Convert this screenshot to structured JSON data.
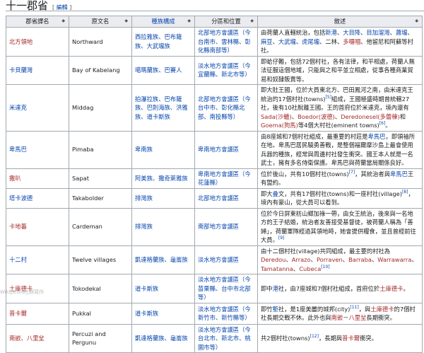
{
  "section": {
    "title": "十一郡省",
    "edit_label": "編輯"
  },
  "columns": [
    "郡省譯名",
    "原文名",
    "種族構成",
    "分區和位置",
    "敘述"
  ],
  "rows": [
    {
      "name": "北方領地",
      "name_red": true,
      "original": "Northward",
      "ethnic": "西拉雅族、巴布薩族、大武壠族",
      "region": "北部地方會議區（今台南市、雲林縣、彰化縣南部等）",
      "h": 38,
      "desc": [
        {
          "t": "由荷蘭人直轄統治，包括"
        },
        {
          "t": "新港",
          "c": "link"
        },
        {
          "t": "、"
        },
        {
          "t": "大目降",
          "c": "link"
        },
        {
          "t": "、"
        },
        {
          "t": "目加溜灣",
          "c": "link"
        },
        {
          "t": "、"
        },
        {
          "t": "蕭壠",
          "c": "link"
        },
        {
          "t": "、"
        },
        {
          "t": "麻豆",
          "c": "link"
        },
        {
          "t": "、"
        },
        {
          "t": "大武壠",
          "c": "link"
        },
        {
          "t": "、"
        },
        {
          "t": "虎尾壠",
          "c": "link"
        },
        {
          "t": "、二林、"
        },
        {
          "t": "多囉嘓",
          "c": "red"
        },
        {
          "t": "、他留尼和阿蘇等村社。"
        }
      ]
    },
    {
      "name": "卡貝蘭灣",
      "name_red": false,
      "original": "Bay of Kabelang",
      "ethnic": "噶瑪蘭族、巴賽人",
      "region": "淡水地方會議區（今宜蘭縣、新北市等）",
      "h": 25,
      "desc": [
        {
          "t": "即蛤仔難，包括72個村社，各有法律，和平相處，荷蘭人無法征服這個地域，只能與之和平並立相處，從事各種商業貿易和奴隸販賣等。"
        }
      ]
    },
    {
      "name": "米達克",
      "name_red": false,
      "original": "Middag",
      "ethnic": "拍瀑拉族、巴布薩族、巴則海族、洪雅族、道卡斯族",
      "region": "北部地方會議區（今台中市、彰化縣北部、南投縣等）",
      "h": 62,
      "desc": [
        {
          "t": "即大肚王國，位於大員東北方、巴田鳳河之南，由米達克王統治的17個村社(towns)"
        },
        {
          "t": "[5]",
          "c": "sup"
        },
        {
          "t": "組成，王國極盛時期曾統轄27社，後有10社脫離王國。王的首府位於米達克，境內還有"
        },
        {
          "t": "Sada(沙轆)",
          "c": "red"
        },
        {
          "t": "、"
        },
        {
          "t": "Boedor(波德)",
          "c": "red"
        },
        {
          "t": "、"
        },
        {
          "t": "Deredonesel(多蕾棟)",
          "c": "red"
        },
        {
          "t": "和"
        },
        {
          "t": "Goema(狗馬)",
          "c": "red"
        },
        {
          "t": "等4個大村社(eminent towns)"
        },
        {
          "t": "[6]",
          "c": "sup"
        },
        {
          "t": "。"
        }
      ]
    },
    {
      "name": "卑馬巴",
      "name_red": false,
      "original": "Pimaba",
      "ethnic": "卑南族",
      "region": "卑南地方會議區",
      "h": 49,
      "desc": [
        {
          "t": "由8座城和7個村社組成，最重要的村莊是"
        },
        {
          "t": "卑馬巴",
          "c": "link"
        },
        {
          "t": "，即領袖所在地。卑馬巴居民驍勇善戰，是整個福爾摩沙島上最會使用兵器的種族，經常與周邊村社發生衝突。國王本人就是一名武士，擁有多名侍衛保護。卑馬巴與荷蘭當局關係良好。"
        }
      ]
    },
    {
      "name": "撒叭",
      "name_red": true,
      "original": "Sapat",
      "ethnic": "阿美族、撒奇萊雅族",
      "region": "卑南地方會議區（今花蓮縣）",
      "h": 26,
      "desc": [
        {
          "t": "位於後山，共有10個村社(towns)"
        },
        {
          "t": "[7]",
          "c": "sup"
        },
        {
          "t": "，其統治者與"
        },
        {
          "t": "卑馬巴",
          "c": "link"
        },
        {
          "t": "王有盟約。"
        }
      ]
    },
    {
      "name": "塔卡波德",
      "name_red": false,
      "original": "Takabolder",
      "ethnic": "排灣族",
      "region": "北部地方會議區",
      "h": 27,
      "desc": [
        {
          "t": "即大"
        },
        {
          "t": "叠",
          "c": "link"
        },
        {
          "t": "文，共有17個村社(towns)和一座村社(village)"
        },
        {
          "t": "[8]",
          "c": "sup"
        },
        {
          "t": "，境內有豪山，從大員可以看到。"
        }
      ]
    },
    {
      "name": "卡地蕃",
      "name_red": true,
      "original": "Cardeman",
      "ethnic": "排灣族",
      "region": "南部地方會議區",
      "h": 38,
      "desc": [
        {
          "t": "位於今日屏東枋山鄉加祿一帶，由女王統治，後來與一名地方的王子結婚，統治者友善接受基督徒，被荷蘭人稱為「善婦」，荷蘭軍隊經過其領地時，她會提供糧食，並且曾經前往大員。"
        },
        {
          "t": "[9]",
          "c": "sup"
        }
      ]
    },
    {
      "name": "十二村",
      "name_red": false,
      "original": "Twelve villages",
      "ethnic": "凱達格蘭族、龜崙族",
      "region": "淡水地方會議區",
      "h": 24,
      "desc": [
        {
          "t": "由十二個村社(village)共同組成，最主要的村社為"
        },
        {
          "t": "Deredou",
          "c": "red"
        },
        {
          "t": "、"
        },
        {
          "t": "Arrazo",
          "c": "red"
        },
        {
          "t": "、"
        },
        {
          "t": "Porraven",
          "c": "red"
        },
        {
          "t": "、"
        },
        {
          "t": "Barraba",
          "c": "red"
        },
        {
          "t": "、"
        },
        {
          "t": "Warrawarra",
          "c": "red"
        },
        {
          "t": "、"
        },
        {
          "t": "Tamatanna",
          "c": "red"
        },
        {
          "t": "、"
        },
        {
          "t": "Cubeca",
          "c": "red"
        },
        {
          "t": "[10]",
          "c": "sup"
        }
      ]
    },
    {
      "name": "土庫德卡",
      "name_red": true,
      "original": "Tokodekal",
      "ethnic": "道卡斯族",
      "region": "淡水地方會議區（今苗栗縣、台中市北部等）",
      "h": 29,
      "desc": [
        {
          "t": "即中"
        },
        {
          "t": "港",
          "c": "link"
        },
        {
          "t": "社，由7座城和7個村社組成，首府位於"
        },
        {
          "t": "土庫德卡",
          "c": "red"
        },
        {
          "t": "。"
        }
      ]
    },
    {
      "name": "普卡爾",
      "name_red": true,
      "original": "Pukkal",
      "ethnic": "道卡斯族",
      "region": "淡水地方會議區（今新竹市、新竹縣等）",
      "h": 30,
      "desc": [
        {
          "t": "即竹"
        },
        {
          "t": "塹",
          "c": "link"
        },
        {
          "t": "社，是1座美麗的城邦(city)"
        },
        {
          "t": "[11]",
          "c": "sup"
        },
        {
          "t": "，與"
        },
        {
          "t": "土庫德卡",
          "c": "red"
        },
        {
          "t": "的7個村社長期交戰不休。此外也與"
        },
        {
          "t": "南嵌",
          "c": "red"
        },
        {
          "t": "－"
        },
        {
          "t": "八里坌",
          "c": "red"
        },
        {
          "t": "長期衝突。"
        }
      ]
    },
    {
      "name": "南嵌、八里坌",
      "name_red": true,
      "original": "Percuzi and Pergunu",
      "ethnic": "凱達格蘭族、龜崙族",
      "region": "淡水地方會議區（今台北市、新北市、桃園市等）",
      "h": 40,
      "desc": [
        {
          "t": "共2個村社(towns)"
        },
        {
          "t": "[12]",
          "c": "sup"
        },
        {
          "t": "，長期與"
        },
        {
          "t": "普卡爾",
          "c": "red"
        },
        {
          "t": "衝突。"
        }
      ]
    }
  ],
  "watermark": "Wikipedia社群寫作"
}
